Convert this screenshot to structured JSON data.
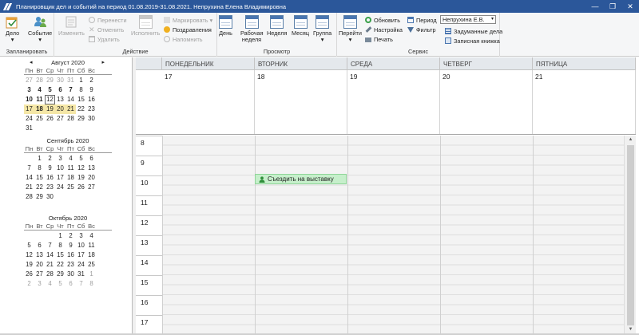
{
  "window": {
    "title": "Планировщик дел и событий на период 01.08.2019-31.08.2021. Непрухина Елена Владимировна",
    "controls": [
      "—",
      "❐",
      "✕"
    ]
  },
  "ribbon": {
    "groups": {
      "planned": "Запланировать",
      "action": "Действие",
      "view": "Просмотр",
      "service": "Сервис"
    },
    "planned": {
      "task": "Дело",
      "event": "Событие"
    },
    "action": {
      "edit": "Изменить",
      "move": "Перенести",
      "cancel": "Отменить",
      "delete": "Удалить",
      "execute": "Исполнить",
      "mark": "Маркировать",
      "congrats": "Поздравления",
      "remind": "Напомнить"
    },
    "view": {
      "day": "День",
      "workweek": "Рабочая неделя",
      "week": "Неделя",
      "month": "Месяц",
      "group": "Группа"
    },
    "service": {
      "goto": "Перейти",
      "refresh": "Обновить",
      "settings": "Настройка",
      "print": "Печать",
      "period": "Период",
      "filter": "Фильтр",
      "user": "Непрухина Е.В.",
      "planned_tasks": "Задуманные дела",
      "notebook": "Записная книжка"
    }
  },
  "calendar": {
    "dow": [
      "Пн",
      "Вт",
      "Ср",
      "Чт",
      "Пт",
      "Сб",
      "Вс"
    ],
    "nav_prev": "◂",
    "nav_next": "▸",
    "months": [
      {
        "title": "Август 2020",
        "weeks": [
          [
            "27",
            "28",
            "29",
            "30",
            "31",
            "1",
            "2"
          ],
          [
            "3",
            "4",
            "5",
            "6",
            "7",
            "8",
            "9"
          ],
          [
            "10",
            "11",
            "12",
            "13",
            "14",
            "15",
            "16"
          ],
          [
            "17",
            "18",
            "19",
            "20",
            "21",
            "22",
            "23"
          ],
          [
            "24",
            "25",
            "26",
            "27",
            "28",
            "29",
            "30"
          ],
          [
            "31",
            "",
            "",
            "",
            "",
            "",
            ""
          ]
        ]
      },
      {
        "title": "Сентябрь 2020",
        "weeks": [
          [
            "",
            "1",
            "2",
            "3",
            "4",
            "5",
            "6"
          ],
          [
            "7",
            "8",
            "9",
            "10",
            "11",
            "12",
            "13"
          ],
          [
            "14",
            "15",
            "16",
            "17",
            "18",
            "19",
            "20"
          ],
          [
            "21",
            "22",
            "23",
            "24",
            "25",
            "26",
            "27"
          ],
          [
            "28",
            "29",
            "30",
            "",
            "",
            "",
            ""
          ]
        ]
      },
      {
        "title": "Октябрь 2020",
        "weeks": [
          [
            "",
            "",
            "",
            "1",
            "2",
            "3",
            "4"
          ],
          [
            "5",
            "6",
            "7",
            "8",
            "9",
            "10",
            "11"
          ],
          [
            "12",
            "13",
            "14",
            "15",
            "16",
            "17",
            "18"
          ],
          [
            "19",
            "20",
            "21",
            "22",
            "23",
            "24",
            "25"
          ],
          [
            "26",
            "27",
            "28",
            "29",
            "30",
            "31",
            "1"
          ],
          [
            "2",
            "3",
            "4",
            "5",
            "6",
            "7",
            "8"
          ]
        ]
      }
    ]
  },
  "schedule": {
    "days": [
      {
        "name": "Понедельник",
        "num": "17"
      },
      {
        "name": "Вторник",
        "num": "18"
      },
      {
        "name": "Среда",
        "num": "19"
      },
      {
        "name": "Четверг",
        "num": "20"
      },
      {
        "name": "Пятница",
        "num": "21"
      }
    ],
    "hours": [
      "8",
      "9",
      "10",
      "11",
      "12",
      "13",
      "14",
      "15",
      "16",
      "17"
    ],
    "events": [
      {
        "title": "Съездить на выставку",
        "day": "Вторник",
        "start_hour": "10"
      }
    ]
  },
  "colors": {
    "titlebar": "#2b579a",
    "event_bg": "#c6efcb",
    "highlight_week": "#f5e7a7"
  }
}
